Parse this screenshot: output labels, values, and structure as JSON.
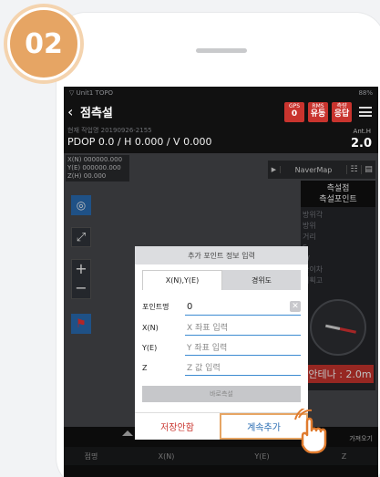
{
  "step_number": "02",
  "status_bar": {
    "left": "▽ Unit1 TOPO",
    "right": "88%"
  },
  "title_bar": {
    "title": "점측설",
    "badges": [
      {
        "top": "GPS",
        "value": "0"
      },
      {
        "top": "RMS",
        "value": "유동"
      },
      {
        "top": "측량",
        "value": "응답"
      }
    ]
  },
  "info": {
    "file_line": "현재 작업명 20190926-2155",
    "pdop": "PDOP 0.0 / H 0.000 / V 0.000",
    "ant_label": "Ant.H",
    "ant_value": "2.0"
  },
  "coords": [
    "X(N) 000000.000",
    "Y(E) 000000.000",
    "Z(H) 00.000"
  ],
  "navermap_label": "NaverMap",
  "side_panel": {
    "header": [
      "측설점",
      "측설포인트"
    ],
    "rows": [
      "방위각",
      "방위",
      "거리",
      "S",
      "W",
      "높이차",
      "지획고"
    ],
    "antenna": "안테나 : 2.0m"
  },
  "dialog": {
    "title": "추가 포인트 정보 입력",
    "tabs": [
      "X(N),Y(E)",
      "경위도"
    ],
    "fields": [
      {
        "label": "포인트명",
        "value": "0",
        "placeholder": ""
      },
      {
        "label": "X(N)",
        "value": "",
        "placeholder": "X 좌표 입력"
      },
      {
        "label": "Y(E)",
        "value": "",
        "placeholder": "Y 좌표 입력"
      },
      {
        "label": "Z",
        "value": "",
        "placeholder": "Z 값 입력"
      }
    ],
    "measure_button": "바로측설",
    "no_save": "저장안함",
    "continue": "계속추가"
  },
  "bottom": {
    "import_label": "가져오기",
    "columns": [
      "점명",
      "X(N)",
      "Y(E)",
      "Z"
    ]
  },
  "colors": {
    "accent": "#e6a564",
    "alert": "#c9342e",
    "primary": "#2a6db3"
  }
}
